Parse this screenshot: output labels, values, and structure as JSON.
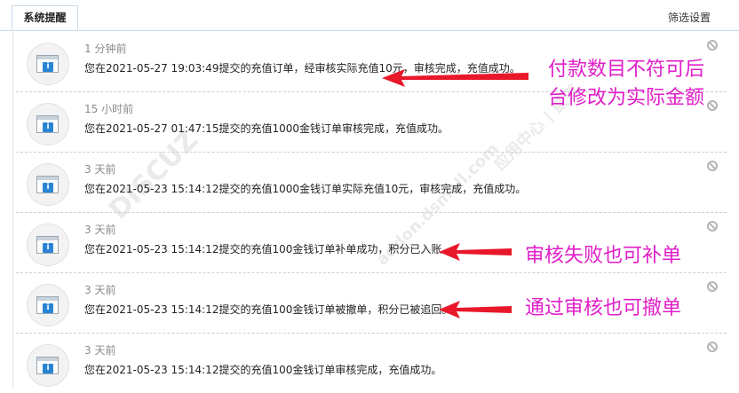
{
  "tabs": {
    "active_label": "系统提醒",
    "filter_label": "筛选设置"
  },
  "notifications": [
    {
      "time": "1 分钟前",
      "message": "您在2021-05-27 19:03:49提交的充值订单，经审核实际充值10元，审核完成，充值成功。"
    },
    {
      "time": "15 小时前",
      "message": "您在2021-05-27 01:47:15提交的充值1000金钱订单审核完成，充值成功。"
    },
    {
      "time": "3 天前",
      "message": "您在2021-05-23 15:14:12提交的充值1000金钱订单实际充值10元，审核完成，充值成功。"
    },
    {
      "time": "3 天前",
      "message": "您在2021-05-23 15:14:12提交的充值100金钱订单补单成功，积分已入账。"
    },
    {
      "time": "3 天前",
      "message": "您在2021-05-23 15:14:12提交的充值100金钱订单被撤单，积分已被追回。"
    },
    {
      "time": "3 天前",
      "message": "您在2021-05-23 15:14:12提交的充值100金钱订单审核完成，充值成功。"
    }
  ],
  "annotations": {
    "note1_line1": "付款数目不符可后",
    "note1_line2": "台修改为实际金额",
    "note2": "审核失败也可补单",
    "note3": "通过审核也可撤单",
    "color": "#e01ec8",
    "arrow_color": "#e8182a"
  },
  "watermark": {
    "text1": "DISCUZ",
    "text2": "addon.dsmall.com",
    "text3": "应用中心 | 贰道"
  },
  "icons": {
    "avatar": "system-notice-icon",
    "delete": "delete-icon"
  }
}
